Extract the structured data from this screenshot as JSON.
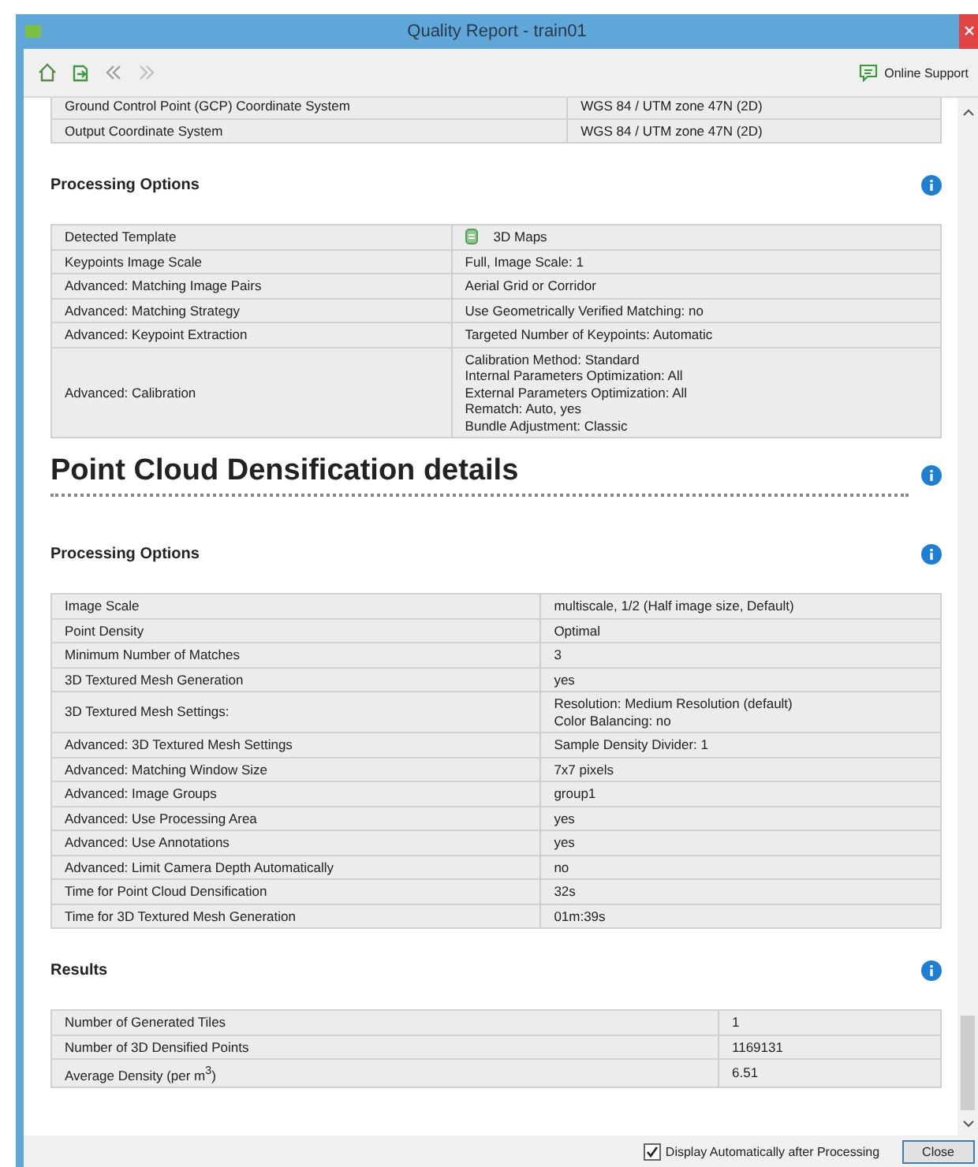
{
  "window": {
    "title": "Quality Report - train01"
  },
  "toolbar": {
    "support_label": "Online Support"
  },
  "sections": [
    {
      "kind": "table",
      "rows": [
        {
          "kind": "text",
          "label": "Ground Control Point (GCP) Coordinate System",
          "value": [
            "WGS 84 / UTM zone 47N (2D)"
          ]
        },
        {
          "kind": "text",
          "label": "Output Coordinate System",
          "value": [
            "WGS 84 / UTM zone 47N (2D)"
          ]
        }
      ]
    },
    {
      "kind": "subheading",
      "title": "Processing Options"
    },
    {
      "kind": "table",
      "rows": [
        {
          "kind": "icon_value",
          "label": "Detected Template",
          "value": [
            "3D Maps"
          ]
        },
        {
          "kind": "text",
          "label": "Keypoints Image Scale",
          "value": [
            "Full, Image Scale: 1"
          ]
        },
        {
          "kind": "text",
          "label": "Advanced: Matching Image Pairs",
          "value": [
            "Aerial Grid or Corridor"
          ]
        },
        {
          "kind": "text",
          "label": "Advanced: Matching Strategy",
          "value": [
            "Use Geometrically Verified Matching: no"
          ]
        },
        {
          "kind": "text",
          "label": "Advanced: Keypoint Extraction",
          "value": [
            "Targeted Number of Keypoints: Automatic"
          ]
        },
        {
          "kind": "text",
          "label": "Advanced: Calibration",
          "value": [
            "Calibration Method: Standard",
            "Internal Parameters Optimization: All",
            "External Parameters Optimization: All",
            "Rematch: Auto, yes",
            "Bundle Adjustment: Classic"
          ]
        }
      ]
    },
    {
      "kind": "heading",
      "title": "Point Cloud Densification details"
    },
    {
      "kind": "subheading",
      "title": "Processing Options"
    },
    {
      "kind": "table",
      "rows": [
        {
          "kind": "text",
          "label": "Image Scale",
          "value": [
            "multiscale, 1/2 (Half image size, Default)"
          ]
        },
        {
          "kind": "text",
          "label": "Point Density",
          "value": [
            "Optimal"
          ]
        },
        {
          "kind": "text",
          "label": "Minimum Number of Matches",
          "value": [
            "3"
          ]
        },
        {
          "kind": "text",
          "label": "3D Textured Mesh Generation",
          "value": [
            "yes"
          ]
        },
        {
          "kind": "text",
          "label": "3D Textured Mesh Settings:",
          "value": [
            "Resolution: Medium Resolution (default)",
            "Color Balancing: no"
          ]
        },
        {
          "kind": "text",
          "label": "Advanced: 3D Textured Mesh Settings",
          "value": [
            "Sample Density Divider: 1"
          ]
        },
        {
          "kind": "text",
          "label": "Advanced: Matching Window Size",
          "value": [
            "7x7 pixels"
          ]
        },
        {
          "kind": "text",
          "label": "Advanced: Image Groups",
          "value": [
            "group1"
          ]
        },
        {
          "kind": "text",
          "label": "Advanced: Use Processing Area",
          "value": [
            "yes"
          ]
        },
        {
          "kind": "text",
          "label": "Advanced: Use Annotations",
          "value": [
            "yes"
          ]
        },
        {
          "kind": "text",
          "label": "Advanced: Limit Camera Depth Automatically",
          "value": [
            "no"
          ]
        },
        {
          "kind": "text",
          "label": "Time for Point Cloud Densification",
          "value": [
            "32s"
          ]
        },
        {
          "kind": "text",
          "label": "Time for 3D Textured Mesh Generation",
          "value": [
            "01m:39s"
          ]
        }
      ]
    },
    {
      "kind": "subheading",
      "title": "Results"
    },
    {
      "kind": "table",
      "rows": [
        {
          "kind": "text",
          "label": "Number of Generated Tiles",
          "value": [
            "1"
          ]
        },
        {
          "kind": "text",
          "label": "Number of 3D Densified Points",
          "value": [
            "1169131"
          ]
        },
        {
          "kind": "text",
          "label": "Average Density (per m$^{3}$)",
          "value": [
            "6.51"
          ]
        }
      ]
    }
  ],
  "footer": {
    "checkbox": {
      "label": "Display Automatically after Processing",
      "checked": true
    },
    "close_button": "Close"
  }
}
